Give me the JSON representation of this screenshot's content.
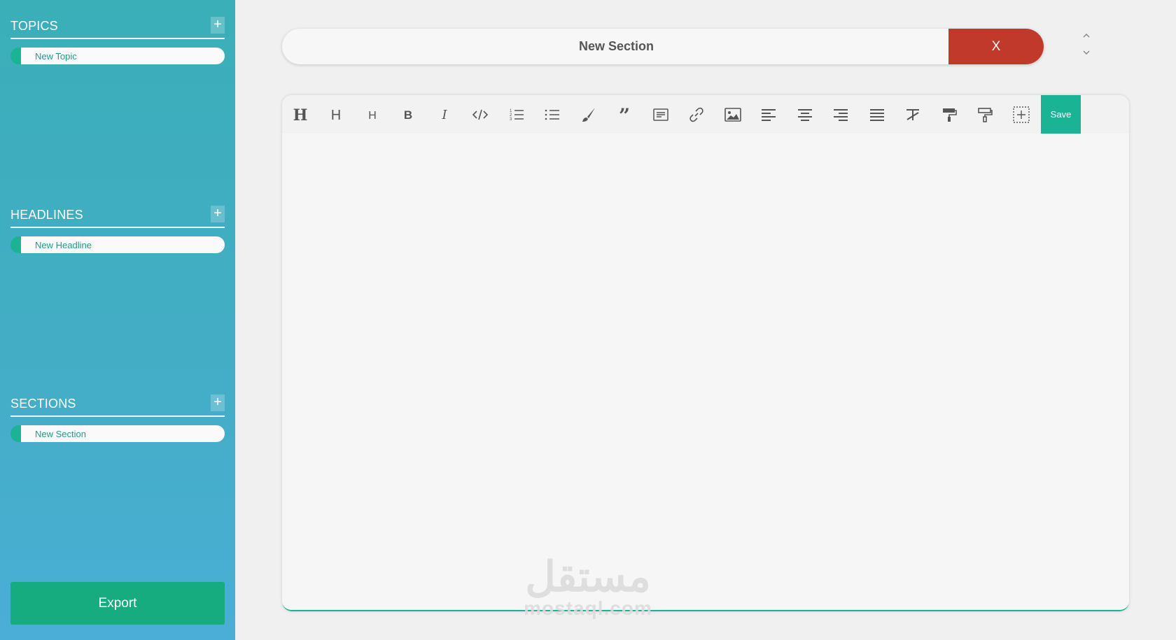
{
  "sidebar": {
    "groups": [
      {
        "title": "TOPICS",
        "add_label": "+",
        "items": [
          {
            "label": "New Topic"
          }
        ]
      },
      {
        "title": "HEADLINES",
        "add_label": "+",
        "items": [
          {
            "label": "New Headline"
          }
        ]
      },
      {
        "title": "SECTIONS",
        "add_label": "+",
        "items": [
          {
            "label": "New Section"
          }
        ]
      }
    ],
    "export_label": "Export"
  },
  "section": {
    "title": "New Section",
    "close_label": "X"
  },
  "toolbar": {
    "tools": [
      {
        "icon": "heading-1-icon"
      },
      {
        "icon": "heading-2-icon"
      },
      {
        "icon": "heading-3-icon"
      },
      {
        "icon": "bold-icon"
      },
      {
        "icon": "italic-icon"
      },
      {
        "icon": "code-icon"
      },
      {
        "icon": "ordered-list-icon"
      },
      {
        "icon": "unordered-list-icon"
      },
      {
        "icon": "brush-icon"
      },
      {
        "icon": "quote-icon"
      },
      {
        "icon": "text-block-icon"
      },
      {
        "icon": "link-icon"
      },
      {
        "icon": "image-icon"
      },
      {
        "icon": "align-left-icon"
      },
      {
        "icon": "align-center-icon"
      },
      {
        "icon": "align-right-icon"
      },
      {
        "icon": "align-justify-icon"
      },
      {
        "icon": "clear-format-icon"
      },
      {
        "icon": "format-painter-icon"
      },
      {
        "icon": "format-painter-outline-icon"
      },
      {
        "icon": "add-block-icon"
      }
    ],
    "save_label": "Save"
  },
  "watermark": {
    "arabic": "مستقل",
    "latin": "mostaql.com"
  },
  "colors": {
    "accent": "#1ab394",
    "danger": "#c0392b",
    "sidebar_top": "#3aafb8",
    "sidebar_bottom": "#4aaed6"
  }
}
